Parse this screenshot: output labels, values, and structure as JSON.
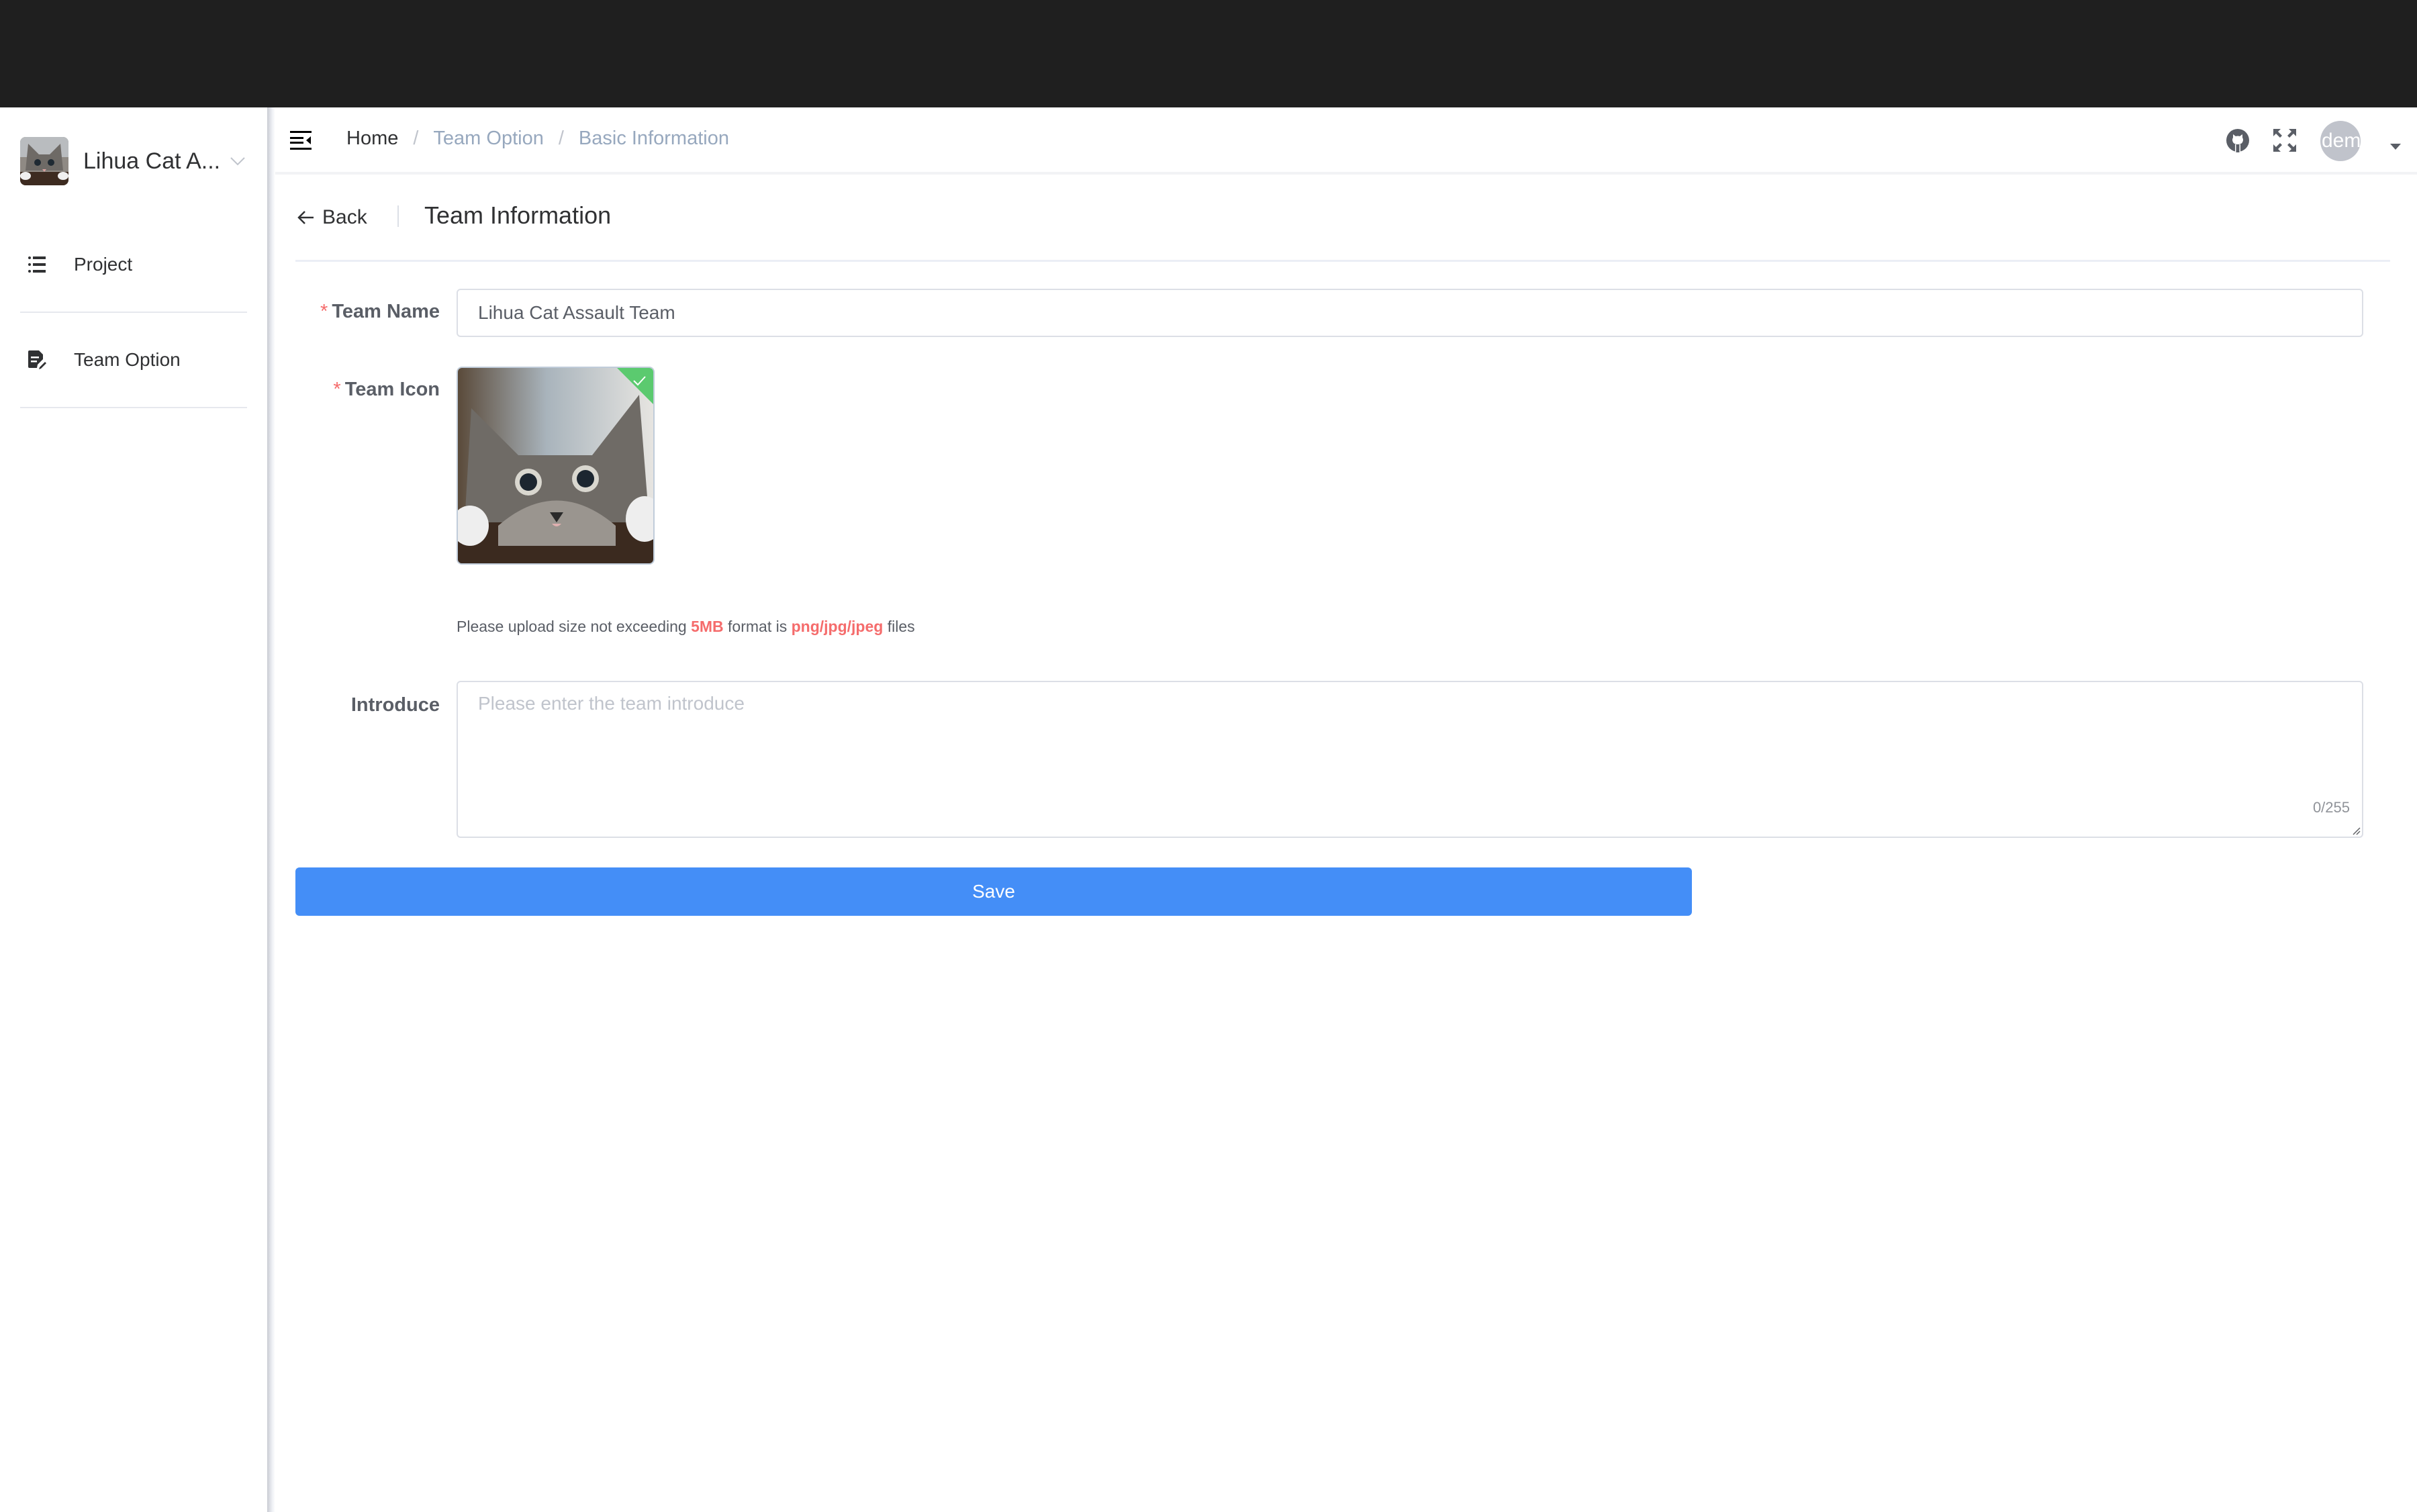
{
  "sidebar": {
    "team_switcher": {
      "name": "Lihua Cat A...",
      "avatar_icon": "cat-photo"
    },
    "items": [
      {
        "label": "Project",
        "icon": "list-icon"
      },
      {
        "label": "Team Option",
        "icon": "document-edit-icon"
      }
    ]
  },
  "header": {
    "menu_toggle_icon": "menu-fold-icon",
    "breadcrumb": [
      "Home",
      "Team Option",
      "Basic Information"
    ],
    "breadcrumb_separator": "/",
    "icons": [
      "github-icon",
      "fullscreen-icon"
    ],
    "user": {
      "avatar_text": "demo",
      "caret_icon": "caret-down-icon"
    }
  },
  "page": {
    "back_label": "Back",
    "title": "Team Information"
  },
  "form": {
    "team_name": {
      "label": "Team Name",
      "required_mark": "*",
      "value": "Lihua Cat Assault Team"
    },
    "team_icon": {
      "label": "Team Icon",
      "required_mark": "*",
      "status": "uploaded"
    },
    "upload_tip": {
      "prefix": "Please upload size not exceeding",
      "size": "5MB",
      "middle": "format is",
      "formats": "png/jpg/jpeg",
      "suffix": "files"
    },
    "introduce": {
      "label": "Introduce",
      "placeholder": "Please enter the team introduce",
      "value": "",
      "counter": "0/255"
    },
    "save_label": "Save"
  },
  "colors": {
    "topbar": "#1f1f1f",
    "primary": "#448ef7",
    "required": "#f56c6c",
    "success": "#5bca6f",
    "breadcrumb_muted": "#97a8be"
  }
}
